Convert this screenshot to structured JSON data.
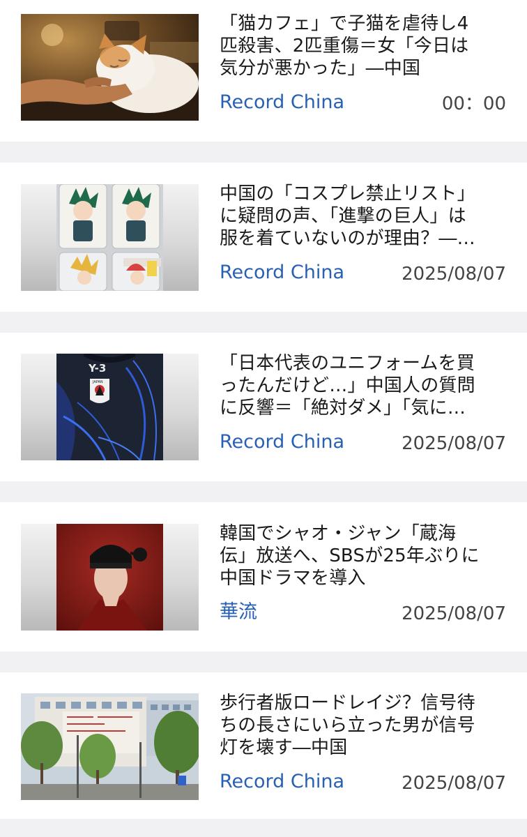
{
  "articles": [
    {
      "title": "「猫カフェ」で子猫を虐待し4\n匹殺害、2匹重傷＝女「今日は\n気分が悪かった」―中国",
      "source": "Record China",
      "time": "00：00",
      "thumbnail_icon": "cat-photo"
    },
    {
      "title": "中国の「コスプレ禁止リスト」\nに疑問の声、「進撃の巨人」は\n服を着ていないのが理由？―…",
      "source": "Record China",
      "time": "2025/08/07",
      "thumbnail_icon": "anime-keychain-photo"
    },
    {
      "title": "「日本代表のユニフォームを買\nったんだけど…」中国人の質問\nに反響＝「絶対ダメ」「気に…",
      "source": "Record China",
      "time": "2025/08/07",
      "thumbnail_icon": "uniform-photo",
      "thumbnail_texts": {
        "brand": "Y-3",
        "crest_label": "JAPAN"
      }
    },
    {
      "title": "韓国でシャオ・ジャン「蔵海\n伝」放送へ、SBSが25年ぶりに\n中国ドラマを導入",
      "source": "華流",
      "time": "2025/08/07",
      "thumbnail_icon": "actor-portrait-photo"
    },
    {
      "title": "歩行者版ロードレイジ？信号待\nちの長さにいら立った男が信号\n灯を壊す―中国",
      "source": "Record China",
      "time": "2025/08/07",
      "thumbnail_icon": "street-photo"
    }
  ]
}
